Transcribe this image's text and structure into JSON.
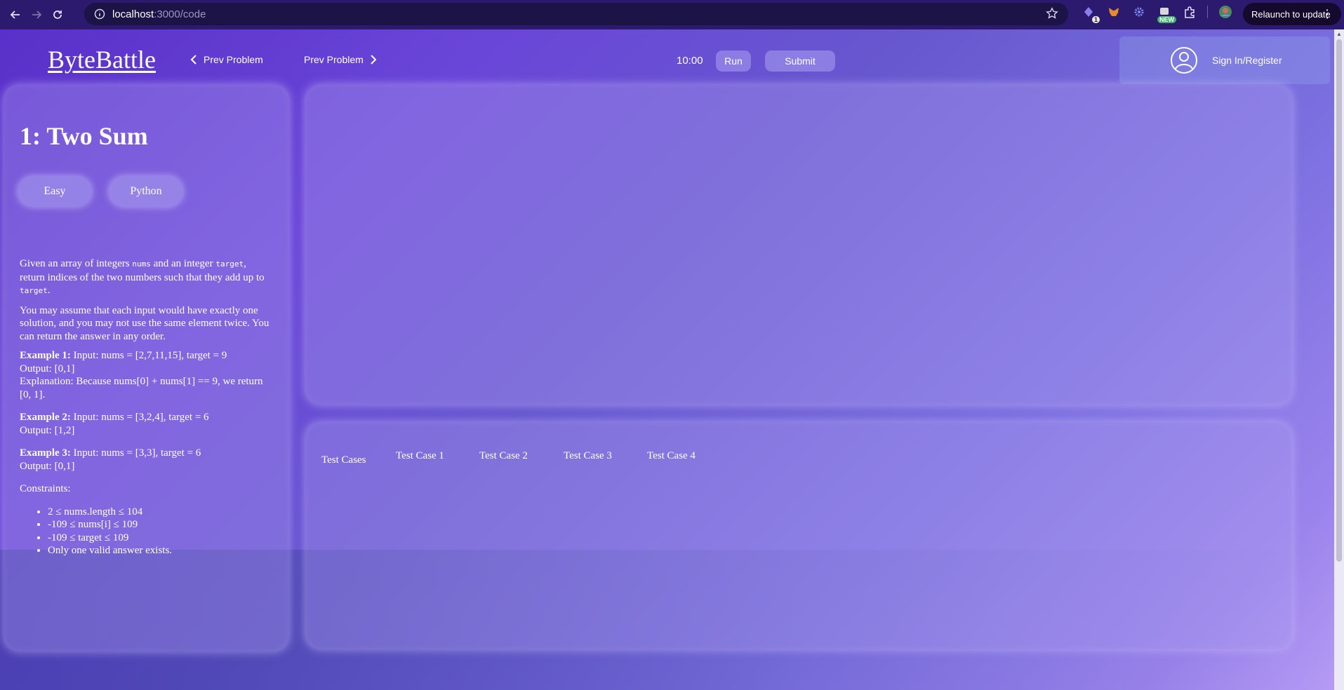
{
  "browser": {
    "url_host": "localhost",
    "url_path": ":3000/code",
    "relaunch_label": "Relaunch to update",
    "extensions": [
      {
        "name": "extension-1-icon",
        "badge": "1"
      },
      {
        "name": "metamask-fox-icon",
        "badge": ""
      },
      {
        "name": "gear-extension-icon",
        "badge": ""
      },
      {
        "name": "new-extension-icon",
        "badge": "NEW"
      },
      {
        "name": "puzzle-extensions-icon",
        "badge": ""
      },
      {
        "name": "profile-avatar-icon",
        "badge": ""
      }
    ]
  },
  "header": {
    "logo": "ByteBattle",
    "prev_problem_left": "Prev Problem",
    "prev_problem_right": "Prev Problem",
    "timer": "10:00",
    "run_label": "Run",
    "submit_label": "Submit",
    "auth_label": "Sign In/Register"
  },
  "problem": {
    "title": "1: Two Sum",
    "difficulty": "Easy",
    "language": "Python",
    "desc_p1_a": "Given an array of integers ",
    "desc_p1_code1": "nums",
    "desc_p1_b": " and an integer ",
    "desc_p1_code2": "target",
    "desc_p1_c": ", return indices of the two numbers such that they add up to ",
    "desc_p1_code3": "target",
    "desc_p1_d": ".",
    "desc_p2": "You may assume that each input would have exactly one solution, and you may not use the same element twice. You can return the answer in any order.",
    "examples": [
      {
        "label": "Example 1:",
        "input": " Input: nums = [2,7,11,15], target = 9",
        "output": "Output: [0,1]",
        "explanation": "Explanation: Because nums[0] + nums[1] == 9, we return [0, 1]."
      },
      {
        "label": "Example 2:",
        "input": " Input: nums = [3,2,4], target = 6",
        "output": "Output: [1,2]"
      },
      {
        "label": "Example 3:",
        "input": " Input: nums = [3,3], target = 6",
        "output": "Output: [0,1]"
      }
    ],
    "constraints_label": "Constraints:",
    "constraints": [
      "2 ≤ nums.length ≤ 104",
      "-109 ≤ nums[i] ≤ 109",
      "-109 ≤ target ≤ 109",
      "Only one valid answer exists."
    ]
  },
  "tests": {
    "tabs": [
      "Test Cases",
      "Test Case 1",
      "Test Case 2",
      "Test Case 3",
      "Test Case 4"
    ]
  }
}
